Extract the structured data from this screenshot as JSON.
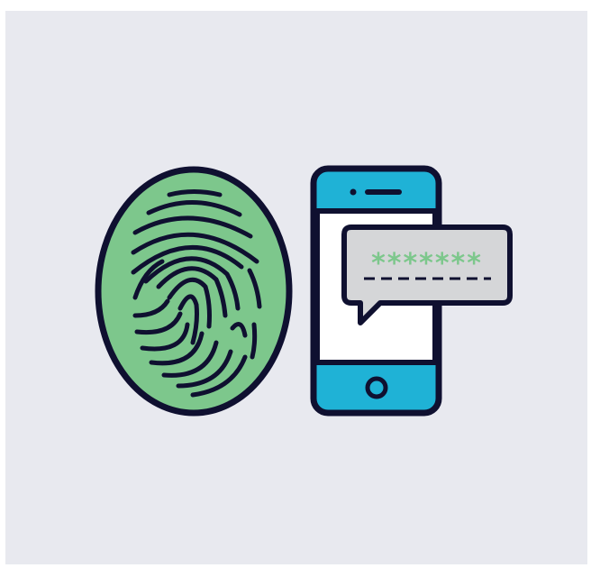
{
  "illustration": {
    "fingerprint": {
      "icon": "fingerprint-icon",
      "fill": "#7dc78c"
    },
    "phone": {
      "icon": "smartphone-icon",
      "body_color": "#1fb2d6",
      "screen_color": "#ffffff"
    },
    "password_bubble": {
      "icon": "speech-bubble-icon",
      "masked_text": "*******",
      "fill": "#d5d6d8",
      "asterisk_color": "#7dc78c"
    },
    "outline_color": "#0f1030",
    "background_color": "#e8e9ef"
  }
}
